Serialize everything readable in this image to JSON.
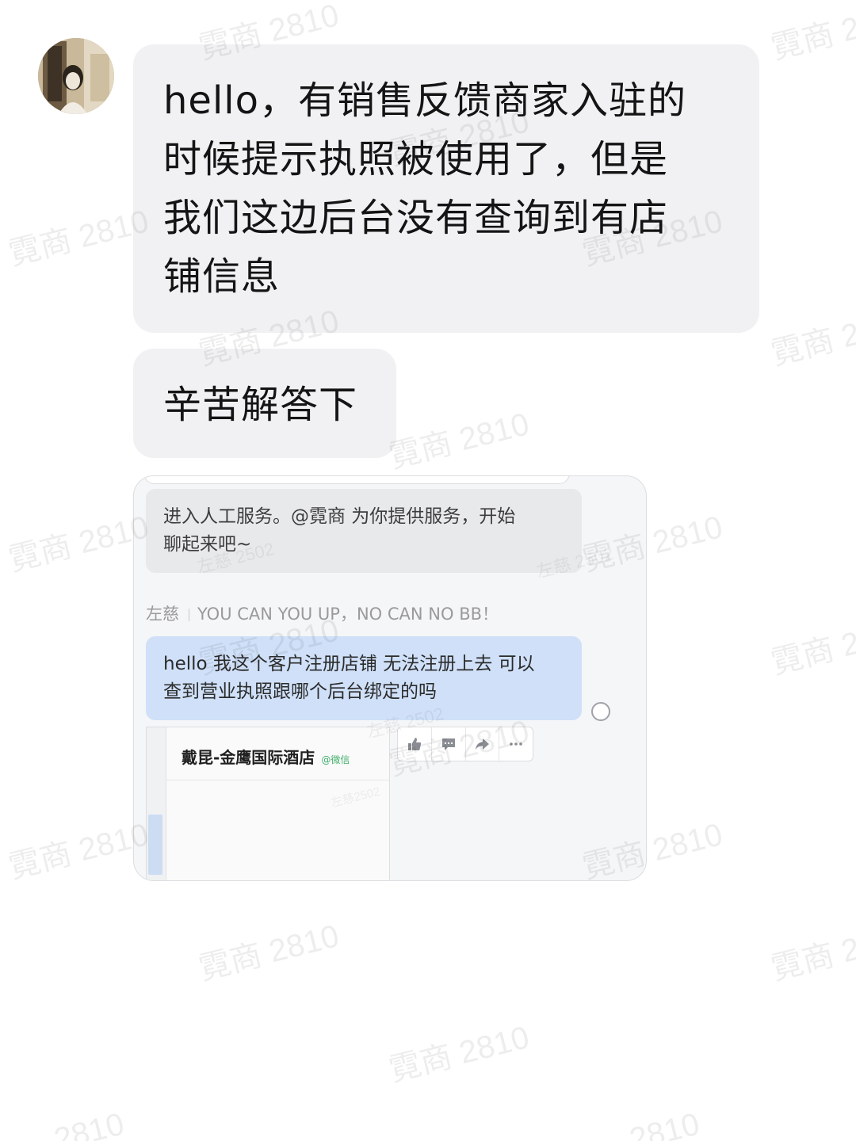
{
  "messages": {
    "line1": "hello，有销售反馈商家入驻的",
    "line2": "时候提示执照被使用了，但是",
    "line3": "我们这边后台没有查询到有店",
    "line4": "铺信息",
    "second": "辛苦解答下"
  },
  "screenshot": {
    "system_line1": "进入人工服务。@霓商 为你提供服务，开始",
    "system_line2": "聊起来吧~",
    "sender_name": "左慈",
    "sender_signature": "YOU CAN YOU UP，NO CAN NO BB！",
    "user_line1": "hello 我这个客户注册店铺 无法注册上去 可以",
    "user_line2": "查到营业执照跟哪个后台绑定的吗",
    "card_title": "戴昆-金鹰国际酒店",
    "card_tag": "@微信",
    "actions": [
      "thumbs-up-icon",
      "comment-icon",
      "forward-icon",
      "more-icon"
    ]
  },
  "watermark": {
    "main": "霓商 2810",
    "partial": "霓商 2",
    "partial_tail": "2810",
    "inner": "左慈 2502",
    "inner_compact": "左慈2502"
  }
}
